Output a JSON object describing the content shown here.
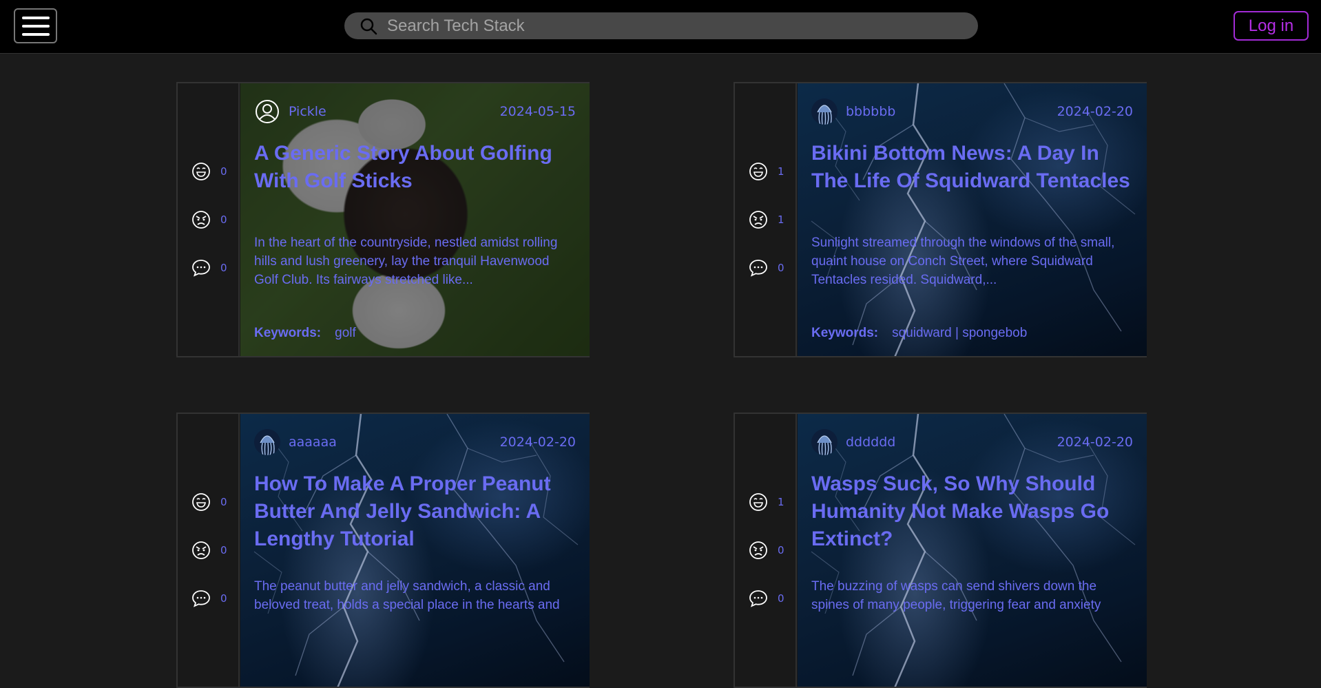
{
  "header": {
    "search_placeholder": "Search Tech Stack",
    "login_label": "Log in"
  },
  "colors": {
    "accent": "#6a6cf2",
    "login": "#b52ee6",
    "background": "#1b1b1b",
    "topbar": "#000000"
  },
  "posts": [
    {
      "author": "Pickle",
      "date": "2024-05-15",
      "title": "A Generic Story About Golfing With Golf Sticks",
      "excerpt": "In the heart of the countryside, nestled amidst rolling hills and lush greenery, lay the tranquil Havenwood Golf Club. Its fairways stretched like...",
      "keywords_label": "Keywords:",
      "keywords": "golf",
      "likes": "0",
      "dislikes": "0",
      "comments": "0",
      "avatar_icon": "user-circle-icon",
      "background": "dog-photo"
    },
    {
      "author": "bbbbbb",
      "date": "2024-02-20",
      "title": "Bikini Bottom News: A Day In The Life Of Squidward Tentacles",
      "excerpt": "Sunlight streamed through the windows of the small, quaint house on Conch Street, where Squidward Tentacles resided. Squidward,...",
      "keywords_label": "Keywords:",
      "keywords": "squidward | spongebob",
      "likes": "1",
      "dislikes": "1",
      "comments": "0",
      "avatar_icon": "jellyfish-avatar",
      "background": "lightning-storm"
    },
    {
      "author": "aaaaaa",
      "date": "2024-02-20",
      "title": "How To Make A Proper Peanut Butter And Jelly Sandwich: A Lengthy Tutorial",
      "excerpt": "The peanut butter and jelly sandwich, a classic and beloved treat, holds a special place in the hearts and",
      "likes": "0",
      "dislikes": "0",
      "comments": "0",
      "avatar_icon": "jellyfish-avatar",
      "background": "lightning-storm"
    },
    {
      "author": "dddddd",
      "date": "2024-02-20",
      "title": "Wasps Suck, So Why Should Humanity Not Make Wasps Go Extinct?",
      "excerpt": "The buzzing of wasps can send shivers down the spines of many people, triggering fear and anxiety",
      "likes": "1",
      "dislikes": "0",
      "comments": "0",
      "avatar_icon": "jellyfish-avatar",
      "background": "lightning-storm"
    }
  ]
}
